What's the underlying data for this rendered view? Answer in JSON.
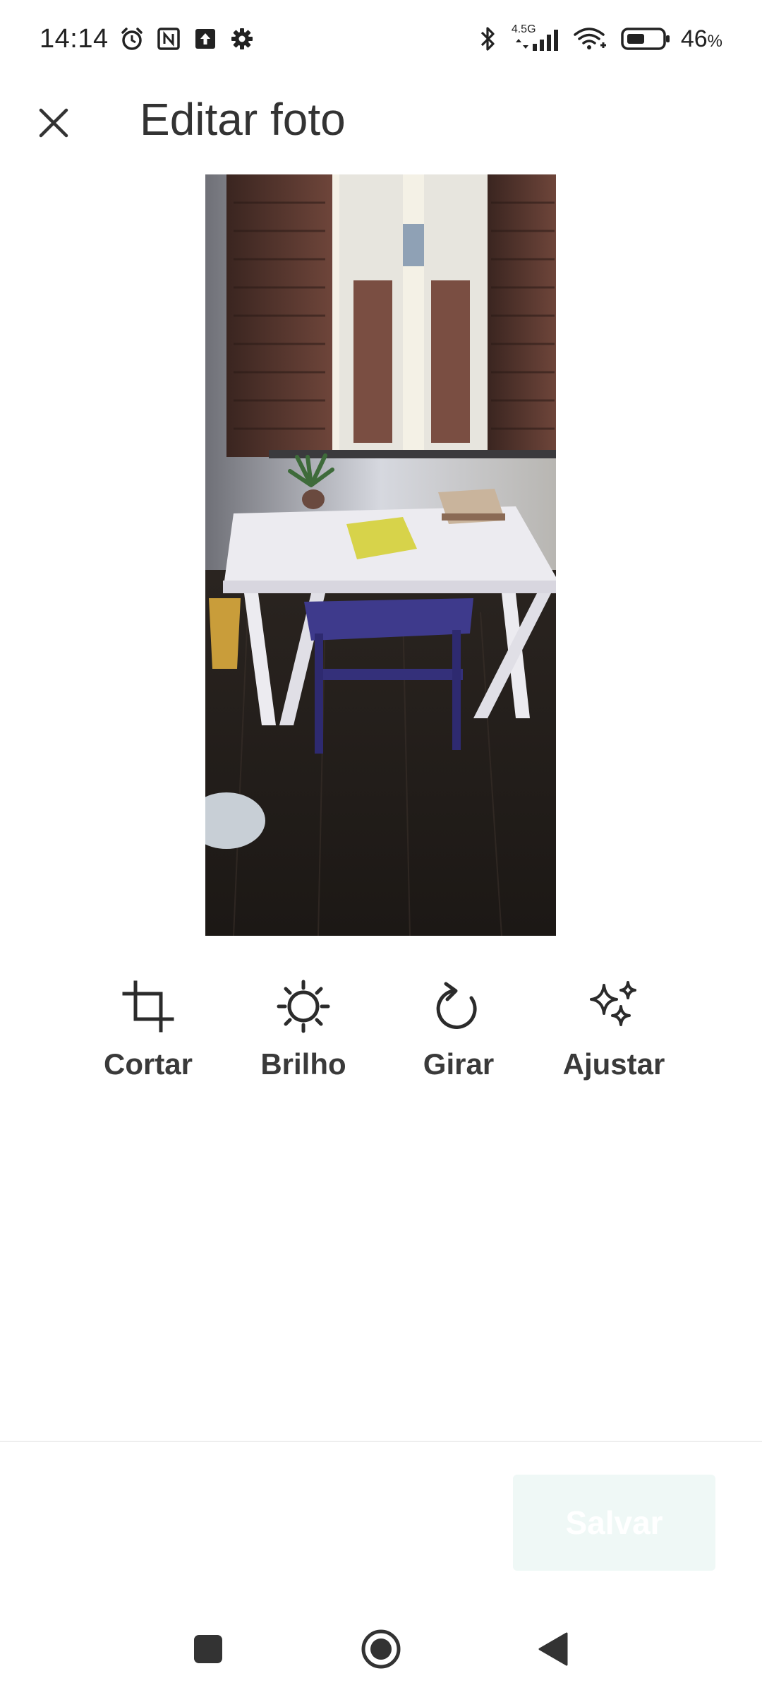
{
  "status_bar": {
    "time": "14:14",
    "network_label": "4.5G",
    "battery_value": "46",
    "battery_unit": "%",
    "icons": [
      "alarm-icon",
      "nfc-icon",
      "upload-icon",
      "settings-icon",
      "bluetooth-icon",
      "signal-icon",
      "wifi-icon",
      "battery-icon"
    ]
  },
  "header": {
    "title": "Editar foto",
    "close_icon": "close-icon"
  },
  "tools": [
    {
      "label": "Cortar",
      "icon": "crop-icon"
    },
    {
      "label": "Brilho",
      "icon": "brightness-icon"
    },
    {
      "label": "Girar",
      "icon": "rotate-icon"
    },
    {
      "label": "Ajustar",
      "icon": "sparkle-icon"
    }
  ],
  "footer": {
    "save_label": "Salvar"
  },
  "colors": {
    "save_disabled_bg": "#eff8f6",
    "text": "#333333",
    "icon": "#2b2b2b"
  }
}
